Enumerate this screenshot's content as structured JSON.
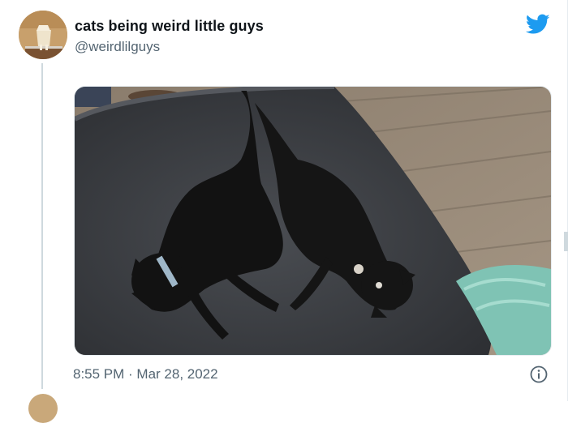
{
  "tweet": {
    "display_name": "cats being weird little guys",
    "handle": "@weirdlilguys",
    "timestamp": "8:55 PM · Mar 28, 2022"
  },
  "icons": {
    "brand": "twitter-bird-icon",
    "info": "info-icon"
  },
  "colors": {
    "twitter_blue": "#1d9bf0",
    "secondary_text": "#536471",
    "thread_line": "#cfd9de"
  }
}
